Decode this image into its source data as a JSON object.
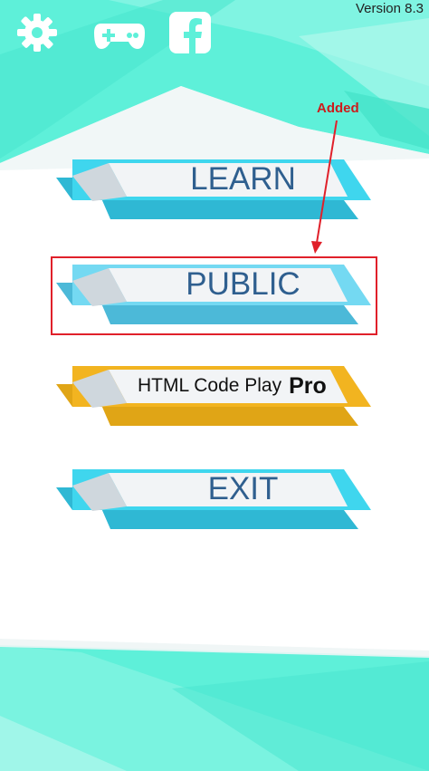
{
  "header": {
    "version": "Version 8.3",
    "icons": [
      "gear-icon",
      "gamepad-icon",
      "facebook-icon"
    ]
  },
  "menu": {
    "learn_label": "LEARN",
    "public_label": "PUBLIC",
    "pro_label": "HTML Code Play",
    "pro_suffix": "Pro",
    "exit_label": "EXIT"
  },
  "annotation": {
    "text": "Added"
  },
  "colors": {
    "teal_bg": "#5ef0d9",
    "cyan_button": "#3fd6ee",
    "gold_button": "#f2b420",
    "label_blue": "#2f5f8f",
    "annotation_red": "#e0202a"
  }
}
